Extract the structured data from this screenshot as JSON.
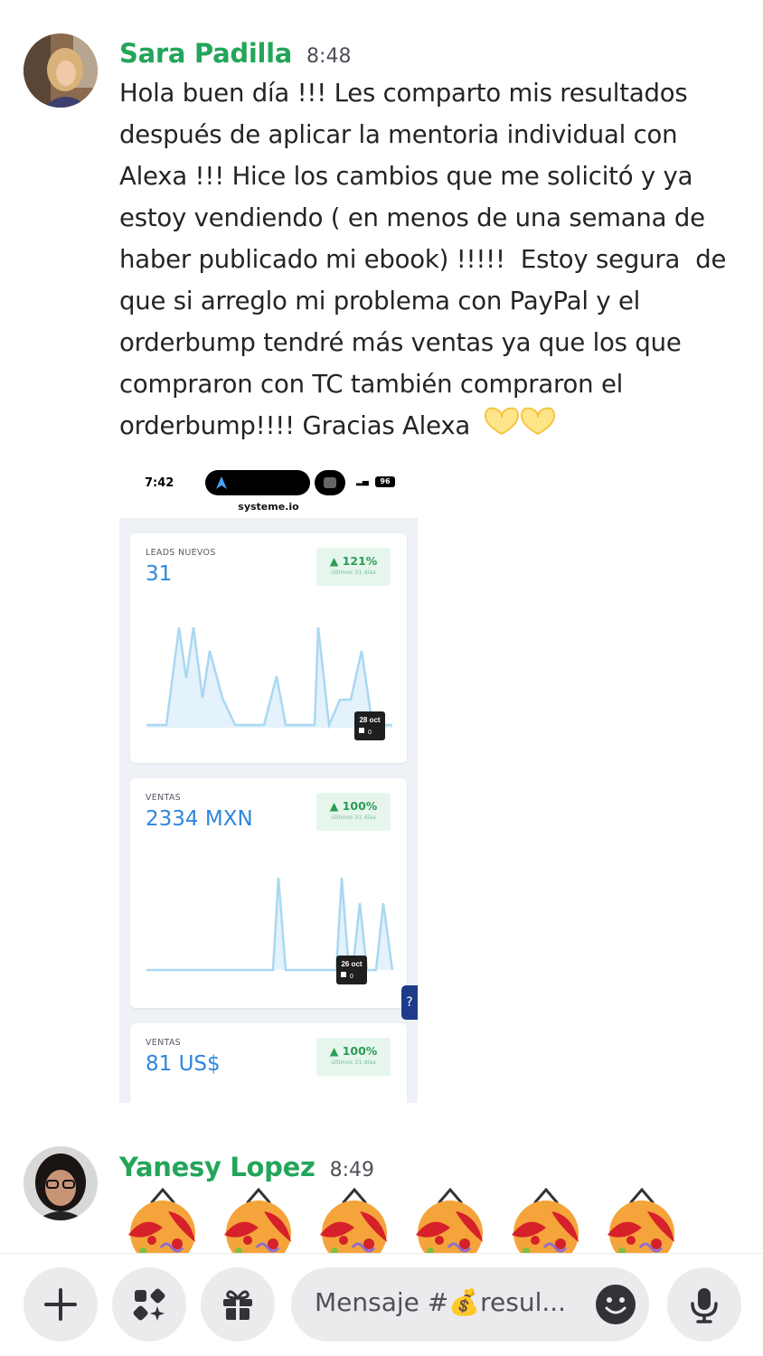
{
  "messages": [
    {
      "author": "Sara Padilla",
      "time": "8:48",
      "lines": [
        "Hola buen día !!! Les comparto mis resultados",
        "después de aplicar la mentoria individual con",
        "Alexa !!! Hice los cambios que me solicitó y ya",
        "estoy vendiendo ( en menos de una semana de",
        "haber publicado mi ebook) !!!!!  Estoy segura  de",
        "que si arreglo mi problema con PayPal y el",
        "orderbump tendré más ventas ya que los que",
        "compraron con TC también compraron el",
        "orderbump!!!! Gracias Alexa"
      ],
      "trailing_emoji": "yellow-heart-hands-icon",
      "attachment": {
        "status_time": "7:42",
        "battery": "96",
        "url": "systeme.io",
        "cards": [
          {
            "label": "LEADS NUEVOS",
            "value": "31",
            "pct": "121%",
            "pct_sub": "últimos 31 días",
            "tooltip_date": "28 oct",
            "tooltip_value": "0"
          },
          {
            "label": "VENTAS",
            "value": "2334 MXN",
            "pct": "100%",
            "pct_sub": "últimos 31 días",
            "tooltip_date": "26 oct",
            "tooltip_value": "0"
          },
          {
            "label": "VENTAS",
            "value": "81 US$",
            "pct": "100%",
            "pct_sub": "últimos 31 días"
          }
        ],
        "help_label": "?"
      }
    },
    {
      "author": "Yanesy Lopez",
      "time": "8:49",
      "emoji": "party-popper-icon",
      "emoji_count": 6
    }
  ],
  "composer": {
    "placeholder": "Mensaje #💰resul...",
    "buttons": [
      "plus-icon",
      "apps-icon",
      "gift-icon",
      "mic-icon"
    ]
  },
  "colors": {
    "author": "#23a55a",
    "text": "#232428",
    "chart_line": "#a9d8f2",
    "chart_fill": "#e3f2fb",
    "value_blue": "#2e86de",
    "pct_green": "#2a9d57"
  }
}
